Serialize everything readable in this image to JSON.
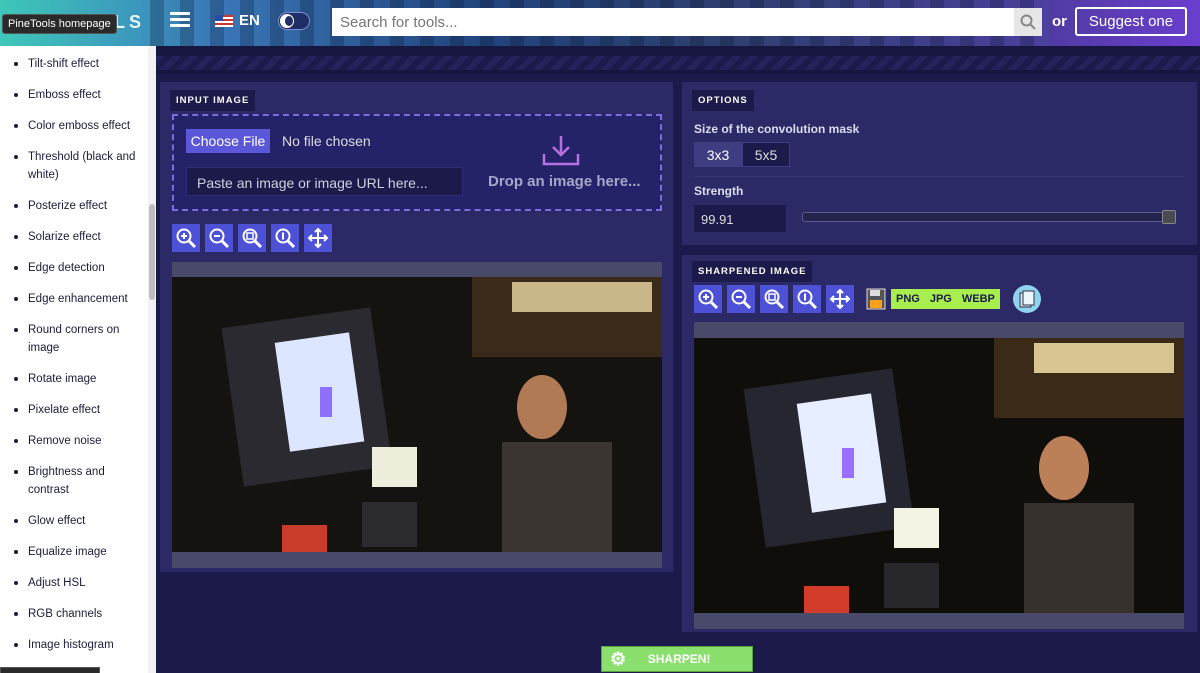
{
  "header": {
    "logo_text": "OLS",
    "logo_tooltip": "PineTools homepage",
    "language": "EN",
    "search_placeholder": "Search for tools...",
    "or_label": "or",
    "suggest_label": "Suggest one"
  },
  "sidebar": {
    "items": [
      {
        "label": "Tilt-shift effect"
      },
      {
        "label": "Emboss effect"
      },
      {
        "label": "Color emboss effect"
      },
      {
        "label": "Threshold (black and white)"
      },
      {
        "label": "Posterize effect"
      },
      {
        "label": "Solarize effect"
      },
      {
        "label": "Edge detection"
      },
      {
        "label": "Edge enhancement"
      },
      {
        "label": "Round corners on image"
      },
      {
        "label": "Rotate image"
      },
      {
        "label": "Pixelate effect"
      },
      {
        "label": "Remove noise"
      },
      {
        "label": "Brightness and contrast"
      },
      {
        "label": "Glow effect"
      },
      {
        "label": "Equalize image"
      },
      {
        "label": "Adjust HSL"
      },
      {
        "label": "RGB channels"
      },
      {
        "label": "Image histogram"
      }
    ]
  },
  "input_panel": {
    "label": "INPUT IMAGE",
    "choose_file": "Choose File",
    "no_file": "No file chosen",
    "paste_placeholder": "Paste an image or image URL here...",
    "drop_text": "Drop an image here..."
  },
  "options_panel": {
    "label": "OPTIONS",
    "mask_title": "Size of the convolution mask",
    "mask_options": [
      "3x3",
      "5x5"
    ],
    "mask_selected": "3x3",
    "strength_title": "Strength",
    "strength_value": "99.91",
    "strength_fraction": 1.0
  },
  "output_panel": {
    "label": "SHARPENED IMAGE",
    "formats": [
      "PNG",
      "JPG",
      "WEBP"
    ]
  },
  "tools": [
    "zoom-in-icon",
    "zoom-out-icon",
    "zoom-fit-icon",
    "zoom-reset-icon",
    "move-icon"
  ],
  "action": {
    "sharpen_label": "SHARPEN!"
  },
  "colors": {
    "accent": "#4c51d6",
    "format_group": "#a8ee4c",
    "sharpen": "#8be06d"
  }
}
